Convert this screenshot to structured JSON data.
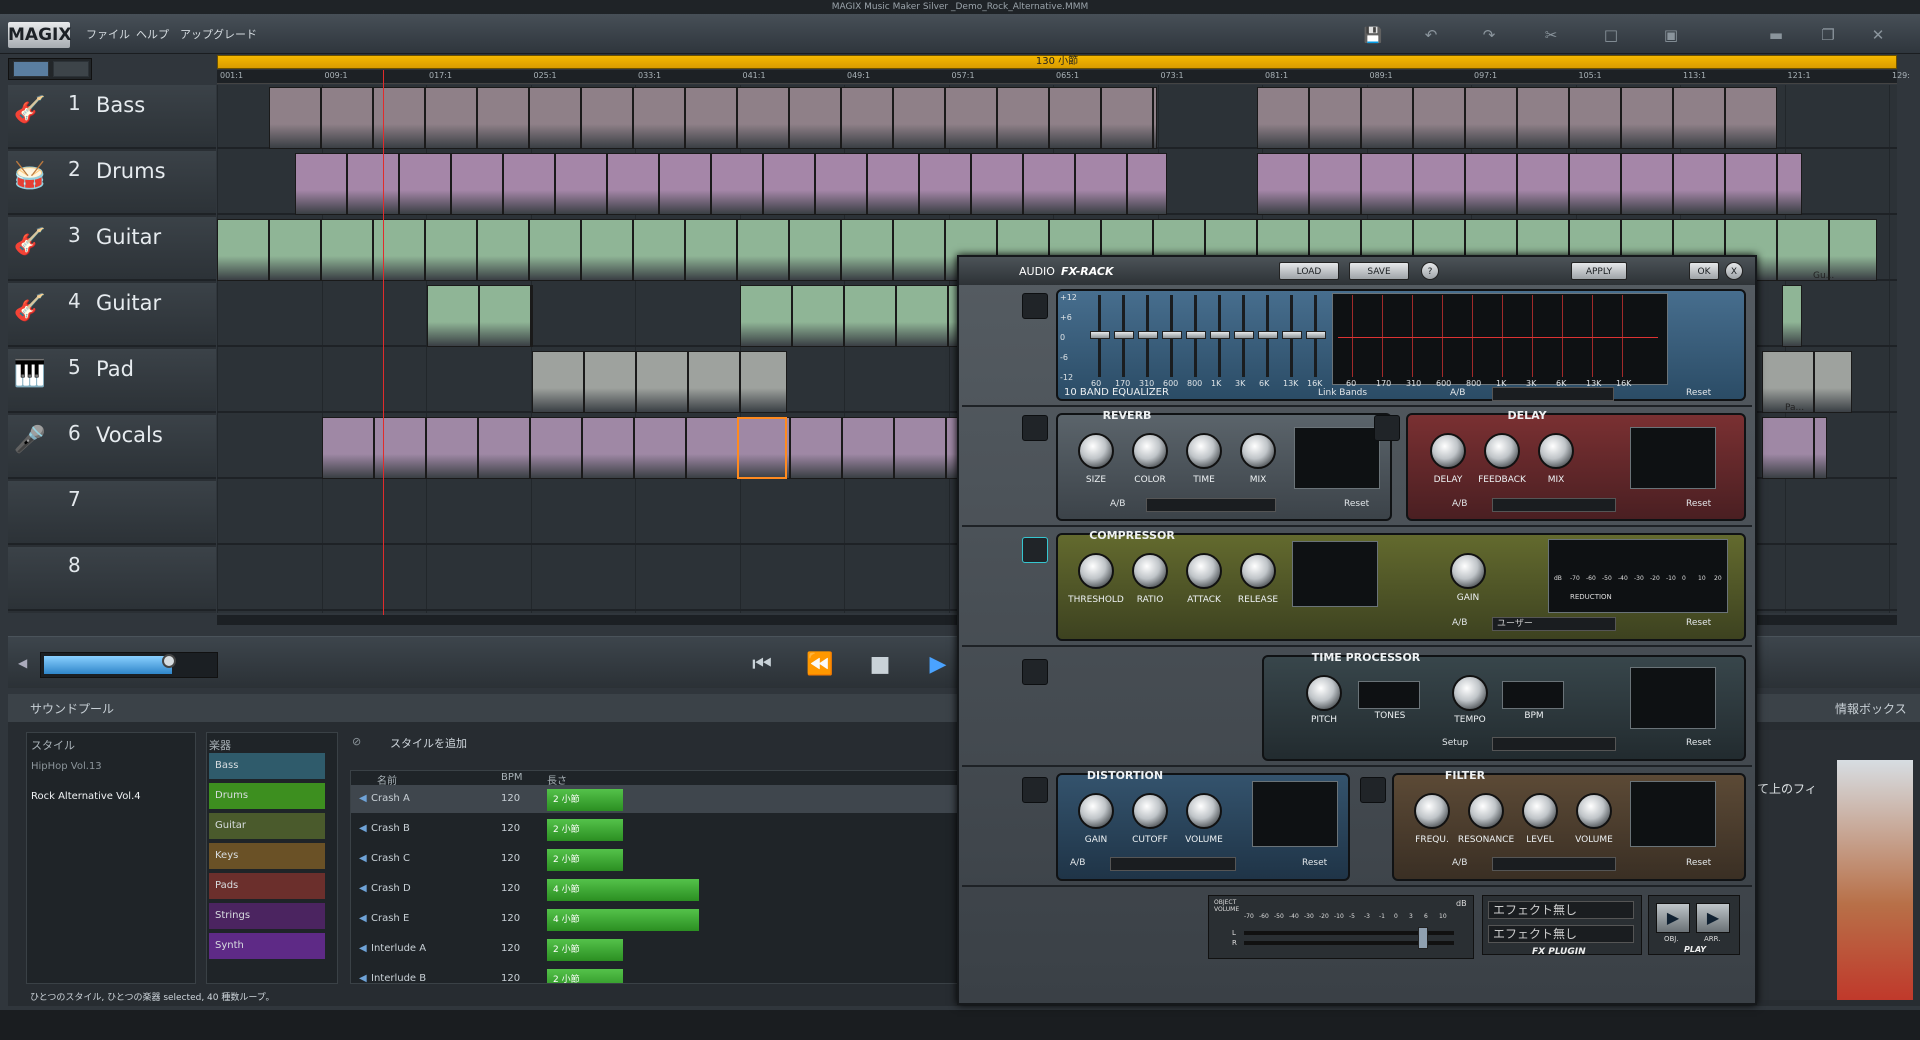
{
  "app": {
    "window_title": "MAGIX Music Maker Silver   _Demo_Rock_Alternative.MMM",
    "logo": "MAGIX",
    "menu": [
      "ファイル",
      "ヘルプ",
      "アップグレード"
    ],
    "toolbar_icons": [
      "save-icon",
      "undo-icon",
      "redo-icon",
      "scissors-icon",
      "copy-icon",
      "paste-icon"
    ],
    "window_controls": [
      "minimize-icon",
      "maximize-icon",
      "close-icon"
    ]
  },
  "arranger": {
    "song_length": "130 小節",
    "ruler": [
      "001:1",
      "009:1",
      "017:1",
      "025:1",
      "033:1",
      "041:1",
      "049:1",
      "057:1",
      "065:1",
      "073:1",
      "081:1",
      "089:1",
      "097:1",
      "105:1",
      "113:1",
      "121:1",
      "129:"
    ],
    "tracks": [
      {
        "num": "1",
        "name": "Bass",
        "icon": "bass-guitar-icon",
        "color": "#8f8088"
      },
      {
        "num": "2",
        "name": "Drums",
        "icon": "drum-icon",
        "color": "#a586a8"
      },
      {
        "num": "3",
        "name": "Guitar",
        "icon": "guitar-icon",
        "color": "#8fb596"
      },
      {
        "num": "4",
        "name": "Guitar",
        "icon": "guitar-icon",
        "color": "#8fb596"
      },
      {
        "num": "5",
        "name": "Pad",
        "icon": "keyboard-icon",
        "color": "#9ea29e"
      },
      {
        "num": "6",
        "name": "Vocals",
        "icon": "microphone-icon",
        "color": "#9f88a5"
      },
      {
        "num": "7",
        "name": "",
        "icon": "",
        "color": ""
      },
      {
        "num": "8",
        "name": "",
        "icon": "",
        "color": ""
      }
    ],
    "clip_labels": {
      "guitar_end": "Gu...",
      "pad_end": "Pa..."
    }
  },
  "transport": {
    "volume": 0.78,
    "buttons": [
      "skip-to-start-icon",
      "rewind-icon",
      "stop-icon",
      "play-icon"
    ]
  },
  "soundpool": {
    "tab": "サウンドプール",
    "info_tab": "情報ボックス",
    "info_snippet": "て上のフィ",
    "style_header": "スタイル",
    "styles": [
      "HipHop Vol.13",
      "Rock Alternative Vol.4"
    ],
    "instrument_header": "楽器",
    "instruments": [
      {
        "name": "Bass",
        "color": "#2f5b6b"
      },
      {
        "name": "Drums",
        "color": "#3d8f1f"
      },
      {
        "name": "Guitar",
        "color": "#4a5a2c"
      },
      {
        "name": "Keys",
        "color": "#6a5126"
      },
      {
        "name": "Pads",
        "color": "#6b2f2c"
      },
      {
        "name": "Strings",
        "color": "#4b2460"
      },
      {
        "name": "Synth",
        "color": "#5e2a86"
      }
    ],
    "add_style": "スタイルを追加",
    "columns": {
      "name": "名前",
      "bpm": "BPM",
      "length": "長さ"
    },
    "loops": [
      {
        "name": "Crash A",
        "bpm": "120",
        "length": "2 小節",
        "bars": 2
      },
      {
        "name": "Crash B",
        "bpm": "120",
        "length": "2 小節",
        "bars": 2
      },
      {
        "name": "Crash C",
        "bpm": "120",
        "length": "2 小節",
        "bars": 2
      },
      {
        "name": "Crash D",
        "bpm": "120",
        "length": "4 小節",
        "bars": 4
      },
      {
        "name": "Crash E",
        "bpm": "120",
        "length": "4 小節",
        "bars": 4
      },
      {
        "name": "Interlude A",
        "bpm": "120",
        "length": "2 小節",
        "bars": 2
      },
      {
        "name": "Interlude B",
        "bpm": "120",
        "length": "2 小節",
        "bars": 2
      }
    ],
    "status": "ひとつのスタイル, ひとつの楽器 selected, 40 種数ループ。"
  },
  "fxrack": {
    "title_a": "AUDIO",
    "title_b": "FX-RACK",
    "load": "LOAD",
    "save": "SAVE",
    "help": "?",
    "apply": "APPLY",
    "ok": "OK",
    "close": "X",
    "eq": {
      "name": "10 BAND EQUALIZER",
      "db_labels": [
        "+12",
        "+6",
        "0",
        "-6",
        "-12"
      ],
      "freqs": [
        "60",
        "170",
        "310",
        "600",
        "800",
        "1K",
        "3K",
        "6K",
        "13K",
        "16K"
      ],
      "link": "Link Bands",
      "ab": "A/B",
      "reset": "Reset"
    },
    "reverb": {
      "title": "REVERB",
      "knobs": [
        "SIZE",
        "COLOR",
        "TIME",
        "MIX"
      ],
      "ab": "A/B",
      "reset": "Reset"
    },
    "delay": {
      "title": "DELAY",
      "knobs": [
        "DELAY",
        "FEEDBACK",
        "MIX"
      ],
      "ab": "A/B",
      "reset": "Reset"
    },
    "compressor": {
      "title": "COMPRESSOR",
      "knobs": [
        "THRESHOLD",
        "RATIO",
        "ATTACK",
        "RELEASE"
      ],
      "gain": "GAIN",
      "ab": "A/B",
      "preset": "ユーザー",
      "reset": "Reset",
      "meter_scale": [
        "dB",
        "-70",
        "-60",
        "-50",
        "-40",
        "-30",
        "-20",
        "-10",
        "0",
        "10",
        "20"
      ],
      "reduction": "REDUCTION"
    },
    "time_processor": {
      "title": "TIME PROCESSOR",
      "pitch": "PITCH",
      "tones": "TONES",
      "tempo": "TEMPO",
      "bpm": "BPM",
      "setup": "Setup",
      "reset": "Reset"
    },
    "distortion": {
      "title": "DISTORTION",
      "knobs": [
        "GAIN",
        "CUTOFF",
        "VOLUME"
      ],
      "ab": "A/B",
      "reset": "Reset"
    },
    "filter": {
      "title": "FILTER",
      "knobs": [
        "FREQU.",
        "RESONANCE",
        "LEVEL",
        "VOLUME"
      ],
      "ab": "A/B",
      "reset": "Reset"
    },
    "footer": {
      "object_volume": "OBJECT VOLUME",
      "db": "dB",
      "scale": [
        "-70",
        "-60",
        "-50",
        "-40",
        "-30",
        "-20",
        "-10",
        "-5",
        "-3",
        "-1",
        "0",
        "3",
        "6",
        "10"
      ],
      "l": "L",
      "r": "R",
      "plugin1": "エフェクト無し",
      "plugin2": "エフェクト無し",
      "fx_plugin": "FX PLUGIN",
      "obj": "OBJ.",
      "arr": "ARR.",
      "play": "PLAY"
    }
  }
}
